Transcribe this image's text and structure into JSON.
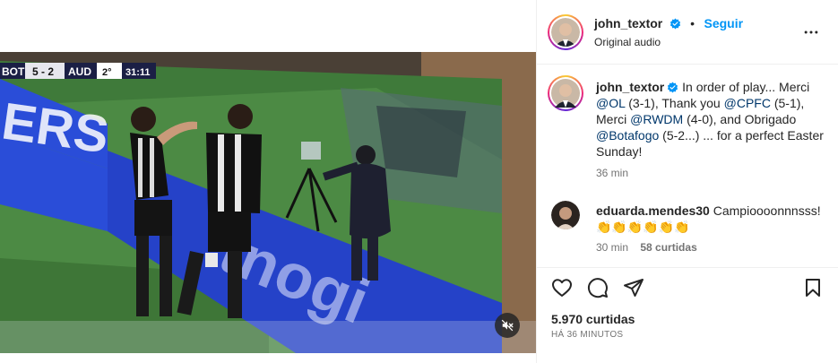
{
  "post": {
    "scoreboard": {
      "home_team": "BOT",
      "score": "5 - 2",
      "away_team": "AUD",
      "period": "2°",
      "clock": "31:11"
    },
    "board_text_left": "ERS",
    "board_text_right": "tnogi",
    "mute_icon": "speaker-muted-icon"
  },
  "header": {
    "username": "john_textor",
    "separator": "•",
    "follow_label": "Seguir",
    "audio": "Original audio",
    "more_icon": "more-horizontal-icon"
  },
  "caption": {
    "username": "john_textor",
    "parts": {
      "p1": " In order of play... Merci ",
      "m1": "@OL",
      "p2": " (3-1), Thank you ",
      "m2": "@CPFC",
      "p3": " (5-1), Merci ",
      "m3": "@RWDM",
      "p4": " (4-0), and Obrigado ",
      "m4": "@Botafogo",
      "p5": " (5-2...) ... for a perfect Easter Sunday!"
    },
    "time": "36 min"
  },
  "comment": {
    "username": "eduarda.mendes30",
    "text": " Campioooonnnsss!",
    "emojis": "👏👏👏👏👏👏",
    "time": "30 min",
    "likes": "58 curtidas"
  },
  "actions": {
    "like_icon": "heart-icon",
    "comment_icon": "comment-icon",
    "share_icon": "send-icon",
    "save_icon": "bookmark-icon"
  },
  "likes_count": "5.970 curtidas",
  "date": "HÁ 36 MINUTOS",
  "colors": {
    "link_blue": "#0095f6",
    "mention_blue": "#00376b",
    "verified_blue": "#0095f6",
    "muted_text": "#737373"
  }
}
